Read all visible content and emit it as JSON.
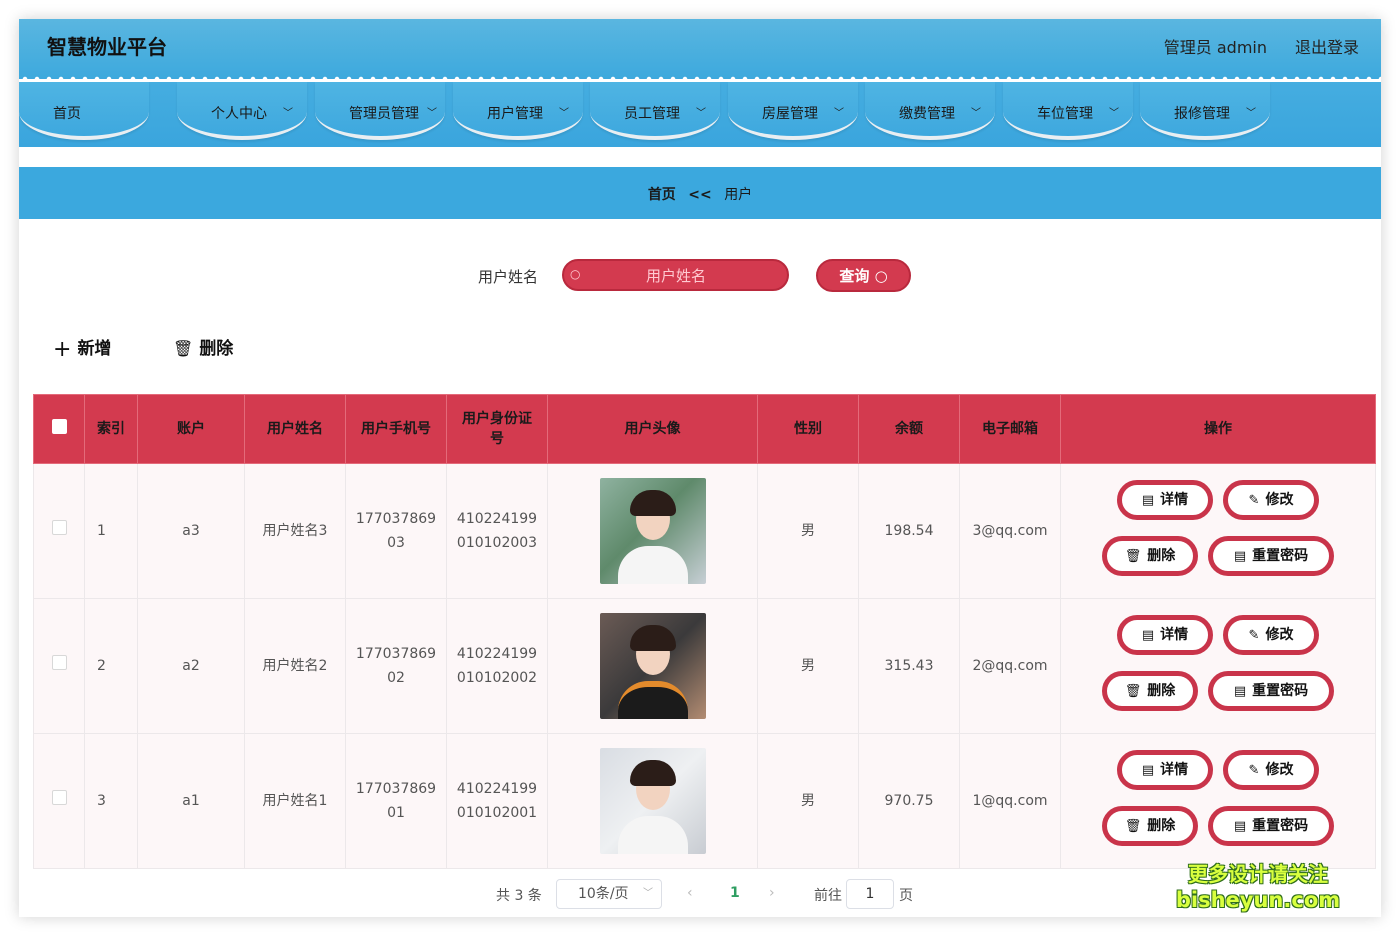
{
  "header": {
    "title": "智慧物业平台",
    "admin_label": "管理员 admin",
    "logout": "退出登录"
  },
  "nav": [
    {
      "label": "首页",
      "has_dropdown": false
    },
    {
      "label": "个人中心",
      "has_dropdown": true
    },
    {
      "label": "管理员管理",
      "has_dropdown": true
    },
    {
      "label": "用户管理",
      "has_dropdown": true
    },
    {
      "label": "员工管理",
      "has_dropdown": true
    },
    {
      "label": "房屋管理",
      "has_dropdown": true
    },
    {
      "label": "缴费管理",
      "has_dropdown": true
    },
    {
      "label": "车位管理",
      "has_dropdown": true
    },
    {
      "label": "报修管理",
      "has_dropdown": true
    }
  ],
  "breadcrumb": {
    "home": "首页",
    "sep": "<<",
    "current": "用户"
  },
  "search": {
    "label": "用户姓名",
    "placeholder": "用户姓名",
    "value": "",
    "button": "查询"
  },
  "actions": {
    "add": "新增",
    "delete": "删除"
  },
  "table": {
    "columns": [
      "索引",
      "账户",
      "用户姓名",
      "用户手机号",
      "用户身份证号",
      "用户头像",
      "性别",
      "余额",
      "电子邮箱",
      "操作"
    ],
    "rows": [
      {
        "index": "1",
        "account": "a3",
        "name": "用户姓名3",
        "phone_a": "177037869",
        "phone_b": "03",
        "id_a": "410224199",
        "id_b": "010102003",
        "gender": "男",
        "balance": "198.54",
        "email": "3@qq.com"
      },
      {
        "index": "2",
        "account": "a2",
        "name": "用户姓名2",
        "phone_a": "177037869",
        "phone_b": "02",
        "id_a": "410224199",
        "id_b": "010102002",
        "gender": "男",
        "balance": "315.43",
        "email": "2@qq.com"
      },
      {
        "index": "3",
        "account": "a1",
        "name": "用户姓名1",
        "phone_a": "177037869",
        "phone_b": "01",
        "id_a": "410224199",
        "id_b": "010102001",
        "gender": "男",
        "balance": "970.75",
        "email": "1@qq.com"
      }
    ],
    "row_ops": {
      "detail": "详情",
      "edit": "修改",
      "delete": "删除",
      "reset": "重置密码"
    }
  },
  "pagination": {
    "total": "共 3 条",
    "page_size": "10条/页",
    "current": "1",
    "goto_label": "前往",
    "goto_value": "1",
    "goto_unit": "页"
  },
  "watermark": {
    "line1": "更多设计请关注",
    "line2": "bisheyun.com"
  },
  "colors": {
    "header_blue": "#3da9dd",
    "accent_red": "#d33a4f",
    "page_active": "#2f9e62"
  }
}
